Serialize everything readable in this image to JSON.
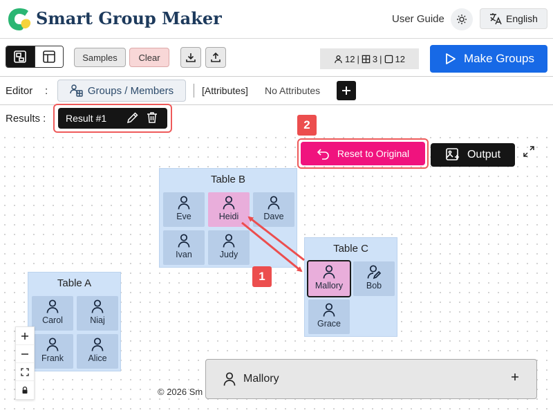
{
  "header": {
    "app_title": "Smart Group Maker",
    "user_guide_label": "User Guide",
    "language_label": "English",
    "icons": [
      "app-logo",
      "sun-icon",
      "translate-icon"
    ]
  },
  "toolbar": {
    "samples_label": "Samples",
    "clear_label": "Clear",
    "stats": {
      "members": "12",
      "tables": "3",
      "seats": "12",
      "separator": "|"
    },
    "make_groups_label": "Make Groups",
    "icons": [
      "layout-canvas-icon",
      "layout-table-icon",
      "download-icon",
      "upload-icon",
      "play-icon"
    ]
  },
  "editor": {
    "label": "Editor",
    "colon": ":",
    "groups_members_label": "Groups / Members",
    "attributes_label": "[Attributes]",
    "no_attributes_label": "No Attributes"
  },
  "results": {
    "label": "Results :",
    "tab_label": "Result #1"
  },
  "canvas": {
    "reset_label": "Reset to Original",
    "output_label": "Output",
    "step_badges": [
      "1",
      "2"
    ],
    "tables": [
      {
        "title": "Table A",
        "members": [
          "Carol",
          "Niaj",
          "Frank",
          "Alice"
        ]
      },
      {
        "title": "Table B",
        "members": [
          "Eve",
          "Heidi",
          "Dave",
          "Ivan",
          "Judy"
        ]
      },
      {
        "title": "Table C",
        "members": [
          "Mallory",
          "Bob",
          "Grace"
        ]
      }
    ],
    "highlighted_member": "Heidi",
    "selected_member": "Mallory",
    "zoom_controls": [
      "+",
      "−"
    ],
    "copyright": "© 2026 Sm"
  },
  "colors": {
    "accent_blue": "#1769e6",
    "reset_pink": "#f0137e",
    "annotation_red": "#ec4e4e",
    "table_bg": "#cfe2f8",
    "member_bg": "#b7cde8",
    "highlight_pink": "#e9aedb"
  },
  "drag_card": {
    "name": "Mallory",
    "plus": "+"
  }
}
